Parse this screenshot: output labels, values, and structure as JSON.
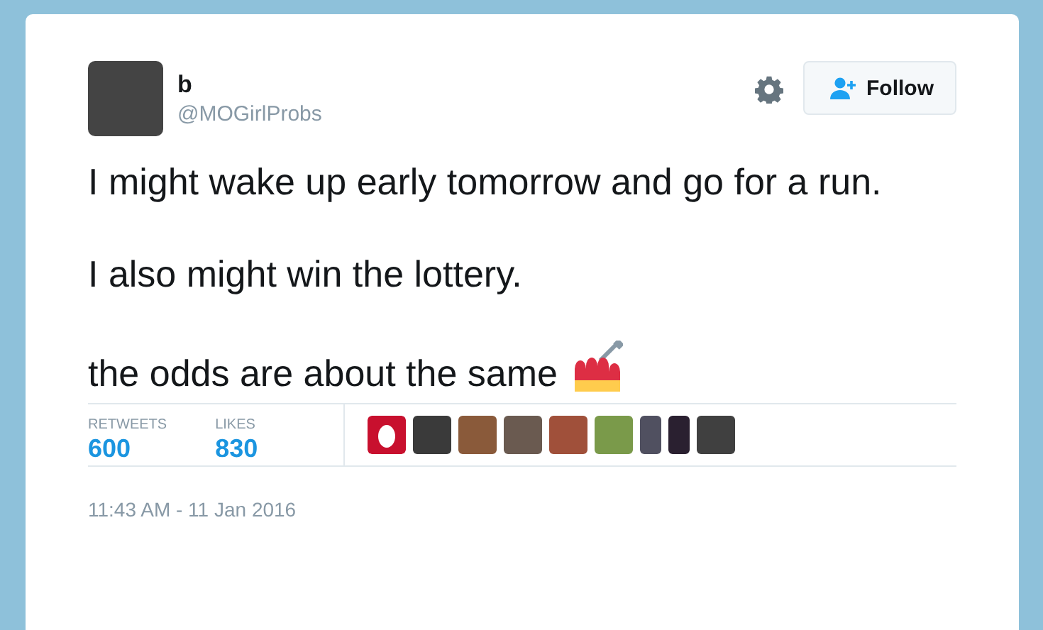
{
  "tweet": {
    "author": {
      "name": "b",
      "handle": "@MOGirlProbs"
    },
    "follow_button": "Follow",
    "paragraphs": [
      "I might wake up early tomorrow and go for a run.",
      "I also might win the lottery.",
      "the odds are about the same"
    ],
    "stats": [
      {
        "label": "RETWEETS",
        "value": "600"
      },
      {
        "label": "LIKES",
        "value": "830"
      }
    ],
    "timestamp": "11:43 AM - 11 Jan 2016"
  }
}
